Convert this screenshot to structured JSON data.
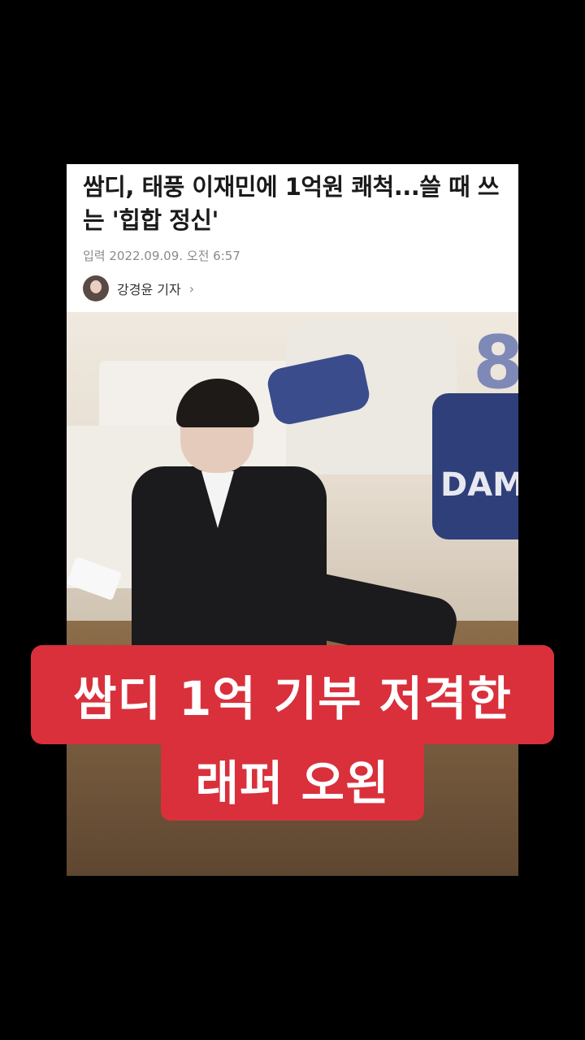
{
  "article": {
    "headline": "쌈디, 태풍 이재민에 1억원 쾌척...쓸 때 쓰는 '힙합 정신'",
    "published": "입력 2022.09.09. 오전 6:57",
    "reporter": "강경윤 기자",
    "chevron": "›"
  },
  "photo": {
    "cake_text": "DAMOI",
    "cake_number": "8"
  },
  "caption": {
    "line1": "쌈디 1억 기부 저격한",
    "line2": "래퍼 오왼"
  }
}
